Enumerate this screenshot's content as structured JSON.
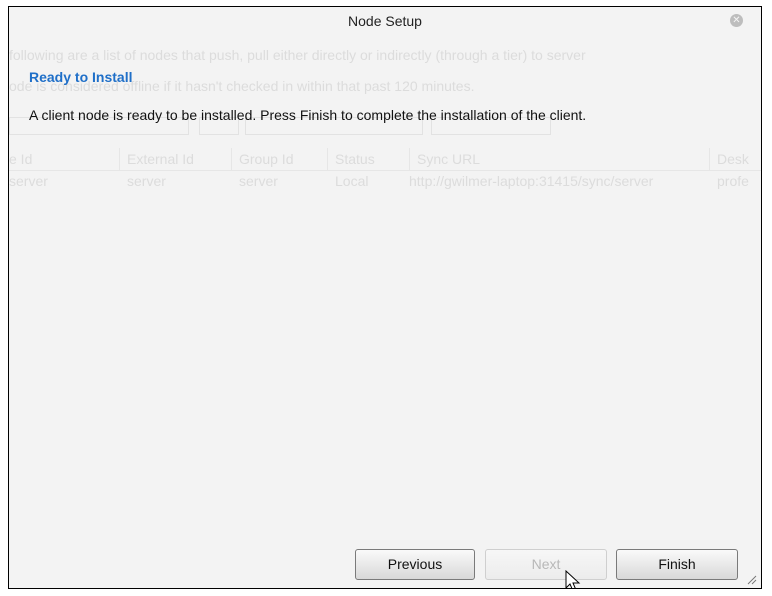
{
  "dialog": {
    "title": "Node Setup",
    "heading": "Ready to Install",
    "message": "A client node is ready to be installed. Press Finish to complete the installation of the client.",
    "buttons": {
      "previous": "Previous",
      "next": "Next",
      "finish": "Finish"
    },
    "close_icon": "close-icon"
  },
  "background": {
    "line1": "following are a list of nodes that push, pull either directly or indirectly (through a tier) to server",
    "line2": "ode is considered offline if it hasn't checked in within that past 120 minutes.",
    "table": {
      "columns": [
        "e Id",
        "External Id",
        "Group Id",
        "Status",
        "Sync URL",
        "Desk"
      ],
      "row": [
        "server",
        "server",
        "server",
        "Local",
        "http://gwilmer-laptop:31415/sync/server",
        "profe"
      ]
    }
  },
  "colors": {
    "accent": "#1f6fc8"
  }
}
